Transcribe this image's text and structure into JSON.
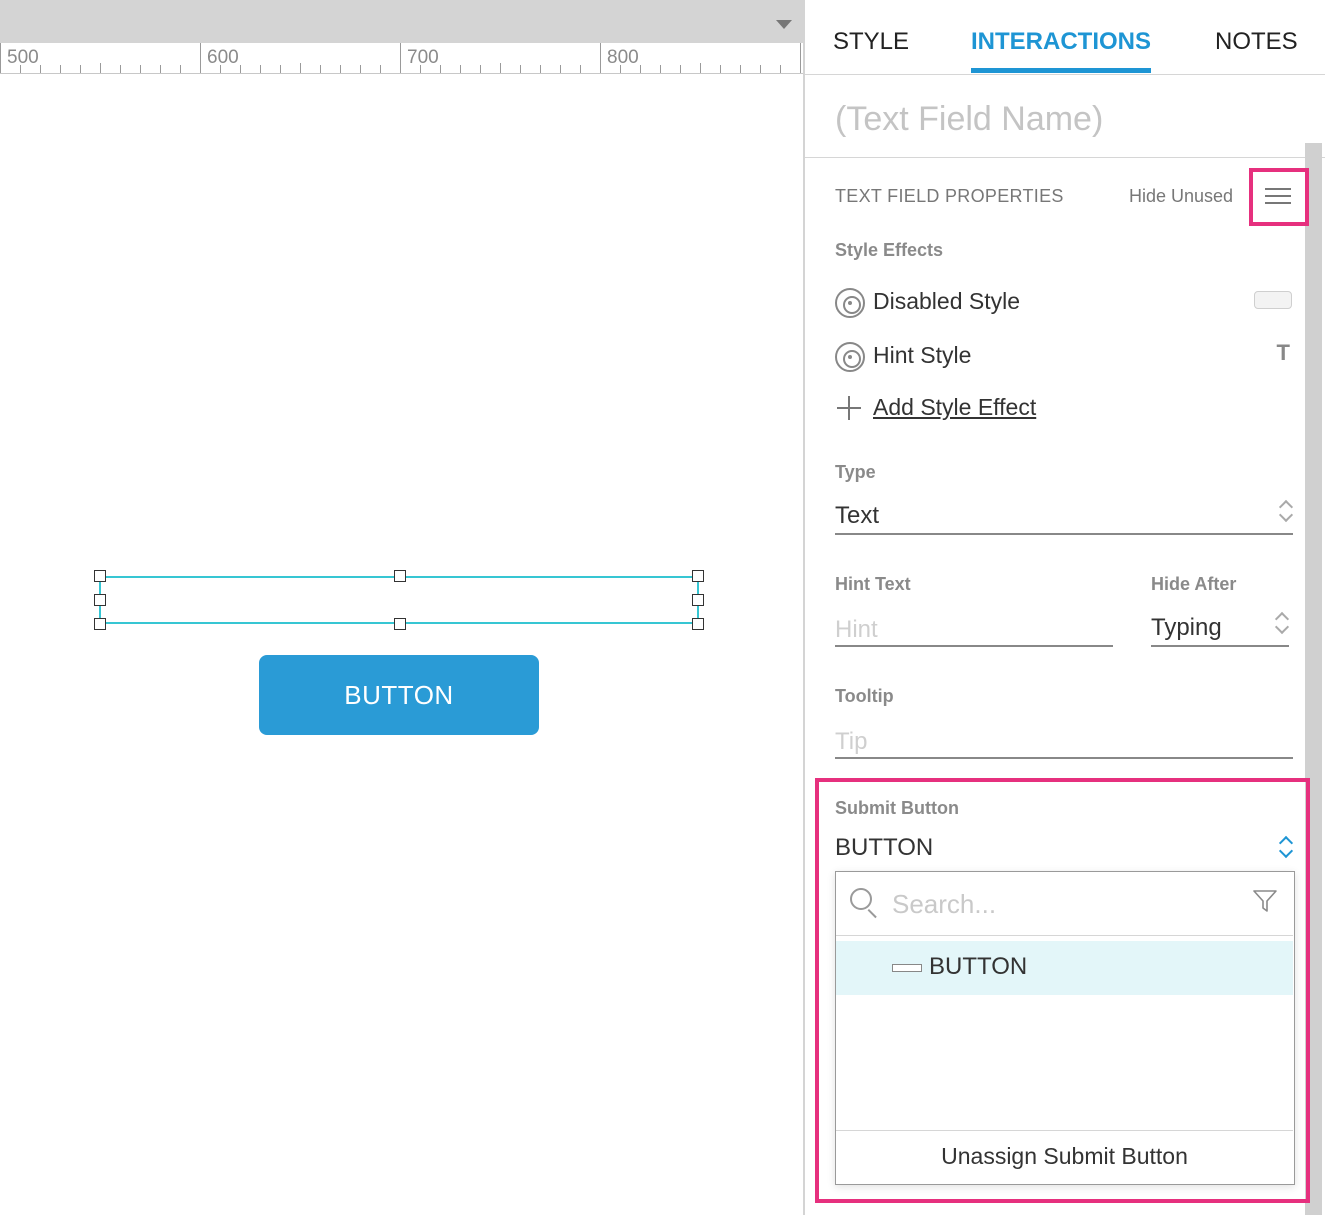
{
  "ruler": {
    "labels": [
      "500",
      "600",
      "700",
      "800"
    ]
  },
  "canvas": {
    "button_label": "BUTTON"
  },
  "tabs": [
    {
      "label": "STYLE",
      "active": false
    },
    {
      "label": "INTERACTIONS",
      "active": true
    },
    {
      "label": "NOTES",
      "active": false
    }
  ],
  "widget": {
    "name_placeholder": "(Text Field Name)"
  },
  "properties": {
    "section_title": "TEXT FIELD PROPERTIES",
    "hide_unused": "Hide Unused",
    "style_effects_label": "Style Effects",
    "effects": [
      {
        "label": "Disabled Style"
      },
      {
        "label": "Hint Style",
        "glyph": "T"
      }
    ],
    "add_effect": "Add Style Effect",
    "type_label": "Type",
    "type_value": "Text",
    "hint_text_label": "Hint Text",
    "hint_placeholder": "Hint",
    "hide_after_label": "Hide After",
    "hide_after_value": "Typing",
    "tooltip_label": "Tooltip",
    "tooltip_placeholder": "Tip",
    "submit_button_label": "Submit Button",
    "submit_button_value": "BUTTON"
  },
  "dropdown": {
    "search_placeholder": "Search...",
    "items": [
      {
        "label": "BUTTON"
      }
    ],
    "unassign": "Unassign Submit Button"
  },
  "colors": {
    "accent": "#1e95d4",
    "highlight": "#e6307e",
    "button_fill": "#2a9bd6",
    "selection": "#36c6d3"
  }
}
